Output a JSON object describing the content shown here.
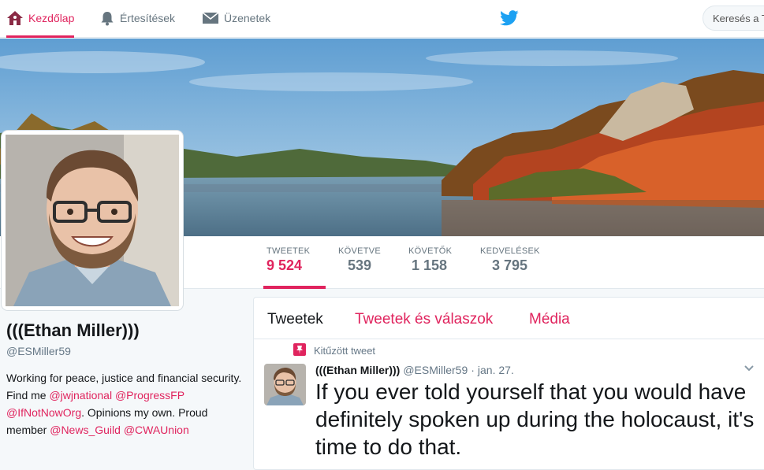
{
  "nav": {
    "home_label": "Kezdőlap",
    "notifications_label": "Értesítések",
    "messages_label": "Üzenetek",
    "search_placeholder": "Keresés a T"
  },
  "colors": {
    "accent": "#e0245e",
    "brand": "#1da1f2",
    "muted": "#657786"
  },
  "icons": {
    "home": "home-icon",
    "notifications": "bell-icon",
    "messages": "envelope-icon",
    "logo": "twitter-bird-icon",
    "pinned": "pin-icon",
    "caret": "chevron-down-icon"
  },
  "stats": [
    {
      "label": "TWEETEK",
      "value": "9 524"
    },
    {
      "label": "KÖVETVE",
      "value": "539"
    },
    {
      "label": "KÖVETŐK",
      "value": "1 158"
    },
    {
      "label": "KEDVELÉSEK",
      "value": "3 795"
    }
  ],
  "profile": {
    "name": "(((Ethan Miller)))",
    "handle": "@ESMiller59",
    "bio": {
      "p1": "Working for peace, justice and financial security. Find me ",
      "l1": "@jwjnational",
      "l2": "@ProgressFP",
      "l3": "@IfNotNowOrg",
      "p2": ". Opinions my own. Proud member ",
      "l4": "@News_Guild",
      "l5": "@CWAUnion"
    }
  },
  "timeline": {
    "tabs": [
      "Tweetek",
      "Tweetek és válaszok",
      "Média"
    ],
    "pinned_label": "Kitűzött tweet",
    "tweet": {
      "name": "(((Ethan Miller)))",
      "handle": "@ESMiller59",
      "separator": "·",
      "date": "jan. 27.",
      "text": "If you ever told yourself that you would have definitely spoken up during the holocaust, it's time to do that."
    }
  }
}
